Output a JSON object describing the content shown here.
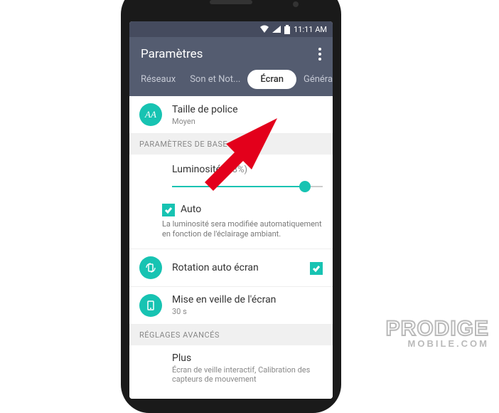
{
  "status": {
    "time": "11:11 AM"
  },
  "header": {
    "title": "Paramètres"
  },
  "tabs": [
    {
      "label": "Réseaux",
      "active": false
    },
    {
      "label": "Son et Not...",
      "active": false
    },
    {
      "label": "Écran",
      "active": true
    },
    {
      "label": "Généralités",
      "active": false
    }
  ],
  "font_row": {
    "title": "Taille de police",
    "sub": "Moyen",
    "icon_text": "AA"
  },
  "sections": {
    "base": "PARAMÈTRES DE BASE",
    "advanced": "RÉGLAGES AVANCÉS"
  },
  "brightness": {
    "label": "Luminosité",
    "pct": "(88%)",
    "value": 88
  },
  "auto": {
    "label": "Auto",
    "checked": true,
    "desc": "La luminosité sera modifiée automatiquement en fonction de l'éclairage ambiant."
  },
  "rotation": {
    "title": "Rotation auto écran",
    "checked": true
  },
  "sleep": {
    "title": "Mise en veille de l'écran",
    "sub": "30 s"
  },
  "more": {
    "title": "Plus",
    "sub": "Écran de veille interactif, Calibration des capteurs de mouvement"
  },
  "watermark": {
    "main": "PRODIGE",
    "sub": "MOBILE.COM"
  },
  "colors": {
    "accent": "#17c3b2",
    "arrow": "#e3001b"
  }
}
